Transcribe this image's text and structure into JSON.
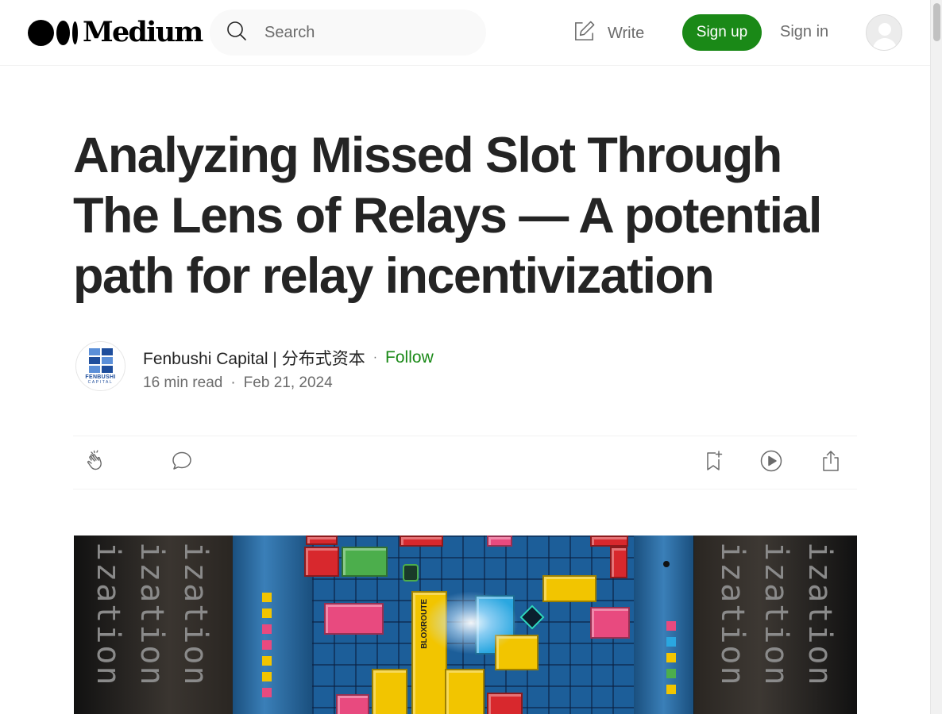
{
  "header": {
    "logo_text": "Medium",
    "search_placeholder": "Search",
    "write_label": "Write",
    "signup_label": "Sign up",
    "signin_label": "Sign in"
  },
  "article": {
    "title": "Analyzing Missed Slot Through The Lens of Relays — A potential path for relay incentivization",
    "author_name": "Fenbushi Capital | 分布式资本",
    "follow_label": "Follow",
    "read_time": "16 min read",
    "date": "Feb 21, 2024",
    "author_avatar_text": "FENBUSHI",
    "author_avatar_subtext": "CAPITAL"
  },
  "hero": {
    "chalk_word": "ization",
    "tile_label": "BLOXROUTE"
  },
  "colors": {
    "accent_green": "#1a8917",
    "text_primary": "#242424",
    "text_secondary": "#6b6b6b"
  },
  "icons": [
    "search-icon",
    "write-icon",
    "user-avatar-icon",
    "clap-icon",
    "comment-icon",
    "bookmark-icon",
    "listen-icon",
    "share-icon"
  ]
}
